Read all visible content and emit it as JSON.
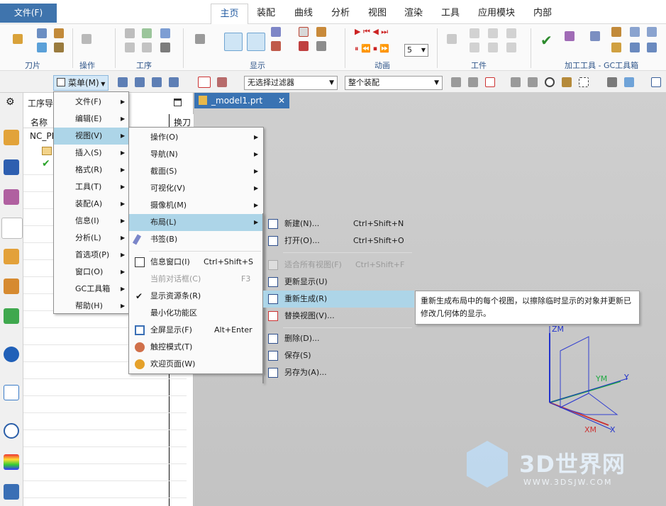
{
  "menubar": {
    "file": "文件(F)",
    "tabs": [
      "主页",
      "装配",
      "曲线",
      "分析",
      "视图",
      "渲染",
      "工具",
      "应用模块",
      "内部"
    ]
  },
  "ribbon": {
    "groups": [
      "刀片",
      "操作",
      "工序",
      "显示",
      "动画",
      "工件",
      "加工工具 - GC工具箱"
    ],
    "spinner_value": "5"
  },
  "toolbar": {
    "menu_button": "菜单(M)",
    "filter": "无选择过滤器",
    "assembly": "整个装配"
  },
  "nav": {
    "title": "工序导",
    "col_name": "名称",
    "col_tool": "换刀",
    "row1": "NC_PR"
  },
  "graphics": {
    "file_tab": "_model1.prt",
    "axes": {
      "z": "ZM",
      "y": "YM",
      "x": "XM",
      "y2": "Y",
      "x2": "X"
    }
  },
  "menu1": [
    "文件(F)",
    "编辑(E)",
    "视图(V)",
    "插入(S)",
    "格式(R)",
    "工具(T)",
    "装配(A)",
    "信息(I)",
    "分析(L)",
    "首选项(P)",
    "窗口(O)",
    "GC工具箱",
    "帮助(H)"
  ],
  "menu2": {
    "items": [
      "操作(O)",
      "导航(N)",
      "截面(S)",
      "可视化(V)",
      "摄像机(M)",
      "布局(L)",
      "书签(B)",
      "信息窗口(I)",
      "当前对话框(C)",
      "显示资源条(R)",
      "最小化功能区",
      "全屏显示(F)",
      "触控模式(T)",
      "欢迎页面(W)"
    ],
    "shortcuts": {
      "info": "Ctrl+Shift+S",
      "dialog": "F3",
      "fullscreen": "Alt+Enter"
    }
  },
  "menu3": {
    "items": [
      "新建(N)...",
      "打开(O)...",
      "适合所有视图(F)",
      "更新显示(U)",
      "重新生成(R)",
      "替换视图(V)...",
      "删除(D)...",
      "保存(S)",
      "另存为(A)..."
    ],
    "shortcuts": {
      "new": "Ctrl+Shift+N",
      "open": "Ctrl+Shift+O",
      "fit": "Ctrl+Shift+F"
    }
  },
  "tooltip": "重新生成布局中的每个视图，以擦除临时显示的对象并更新已修改几何体的显示。",
  "watermark": {
    "brand": "3D世界网",
    "url": "WWW.3DSJW.COM"
  }
}
